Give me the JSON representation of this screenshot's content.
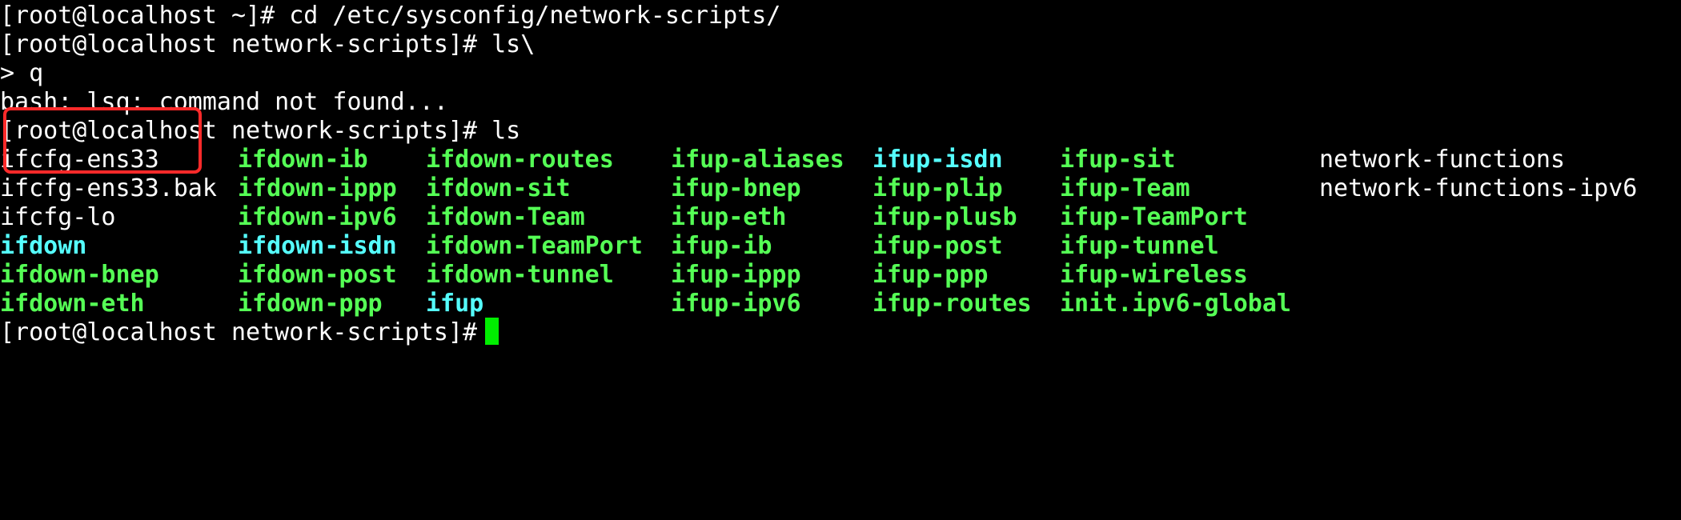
{
  "session": {
    "lines": [
      "[root@localhost ~]# cd /etc/sysconfig/network-scripts/",
      "[root@localhost network-scripts]# ls\\",
      "> q",
      "bash: lsq: command not found...",
      "[root@localhost network-scripts]# ls"
    ],
    "final_prompt": "[root@localhost network-scripts]# "
  },
  "listing": {
    "rows": [
      [
        {
          "text": "ifcfg-ens33",
          "color": "white"
        },
        {
          "text": "ifdown-ib",
          "color": "green"
        },
        {
          "text": "ifdown-routes",
          "color": "green"
        },
        {
          "text": "ifup-aliases",
          "color": "green"
        },
        {
          "text": "ifup-isdn",
          "color": "cyan"
        },
        {
          "text": "ifup-sit",
          "color": "green"
        },
        {
          "text": "network-functions",
          "color": "white"
        }
      ],
      [
        {
          "text": "ifcfg-ens33.bak",
          "color": "white"
        },
        {
          "text": "ifdown-ippp",
          "color": "green"
        },
        {
          "text": "ifdown-sit",
          "color": "green"
        },
        {
          "text": "ifup-bnep",
          "color": "green"
        },
        {
          "text": "ifup-plip",
          "color": "green"
        },
        {
          "text": "ifup-Team",
          "color": "green"
        },
        {
          "text": "network-functions-ipv6",
          "color": "white"
        }
      ],
      [
        {
          "text": "ifcfg-lo",
          "color": "white"
        },
        {
          "text": "ifdown-ipv6",
          "color": "green"
        },
        {
          "text": "ifdown-Team",
          "color": "green"
        },
        {
          "text": "ifup-eth",
          "color": "green"
        },
        {
          "text": "ifup-plusb",
          "color": "green"
        },
        {
          "text": "ifup-TeamPort",
          "color": "green"
        }
      ],
      [
        {
          "text": "ifdown",
          "color": "cyan"
        },
        {
          "text": "ifdown-isdn",
          "color": "cyan"
        },
        {
          "text": "ifdown-TeamPort",
          "color": "green"
        },
        {
          "text": "ifup-ib",
          "color": "green"
        },
        {
          "text": "ifup-post",
          "color": "green"
        },
        {
          "text": "ifup-tunnel",
          "color": "green"
        }
      ],
      [
        {
          "text": "ifdown-bnep",
          "color": "green"
        },
        {
          "text": "ifdown-post",
          "color": "green"
        },
        {
          "text": "ifdown-tunnel",
          "color": "green"
        },
        {
          "text": "ifup-ippp",
          "color": "green"
        },
        {
          "text": "ifup-ppp",
          "color": "green"
        },
        {
          "text": "ifup-wireless",
          "color": "green"
        }
      ],
      [
        {
          "text": "ifdown-eth",
          "color": "green"
        },
        {
          "text": "ifdown-ppp",
          "color": "green"
        },
        {
          "text": "ifup",
          "color": "cyan"
        },
        {
          "text": "ifup-ipv6",
          "color": "green"
        },
        {
          "text": "ifup-routes",
          "color": "green"
        },
        {
          "text": "init.ipv6-global",
          "color": "green"
        }
      ]
    ]
  },
  "colors": {
    "background": "#000000",
    "text": "#ffffff",
    "executable": "#55ff55",
    "symlink": "#55ffff",
    "cursor": "#00ee00",
    "highlight_box": "#ff2a2a"
  }
}
